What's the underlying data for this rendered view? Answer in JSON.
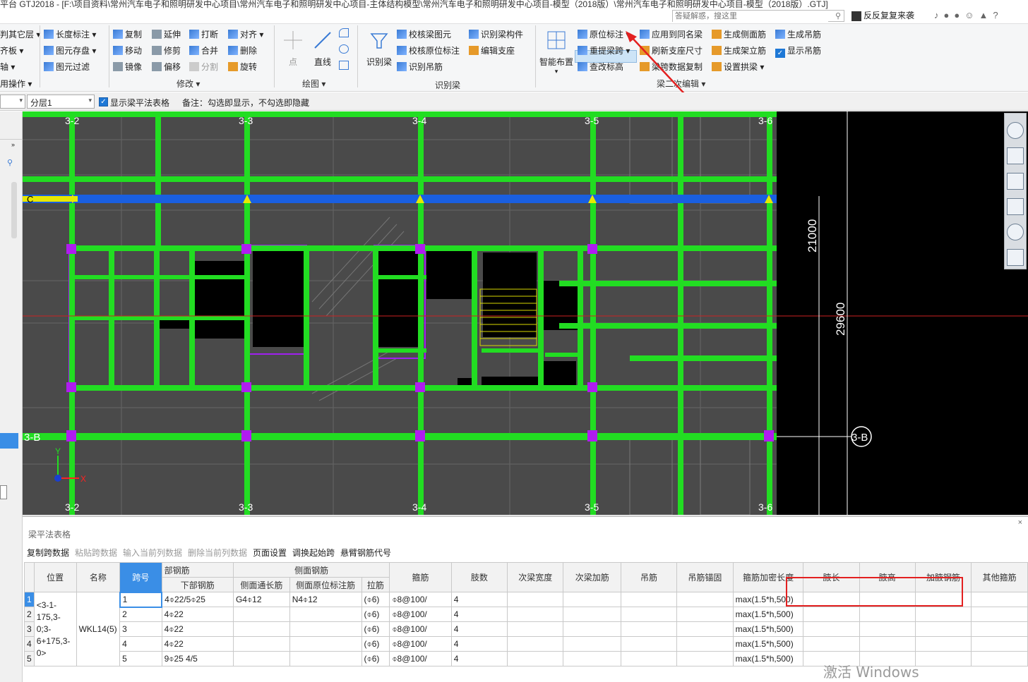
{
  "titlebar": {
    "title": "平台 GTJ2018 - [F:\\项目资料\\常州汽车电子和照明研发中心项目\\常州汽车电子和照明研发中心项目-主体结构模型\\常州汽车电子和照明研发中心项目-模型（2018版）\\常州汽车电子和照明研发中心项目-模型（2018版）.GTJ]",
    "search_placeholder": "答疑解惑，搜这里",
    "user": "反反复复来袭"
  },
  "ribbon": {
    "col1": [
      "判其它层",
      "齐板",
      "轴",
      "用操作"
    ],
    "col2": [
      "长度标注",
      "图元存盘",
      "图元过滤"
    ],
    "modify": {
      "items": [
        "复制",
        "延伸",
        "打断",
        "对齐",
        "移动",
        "修剪",
        "合并",
        "删除",
        "镜像",
        "偏移",
        "分割",
        "旋转"
      ],
      "label": "修改"
    },
    "draw": {
      "point": "点",
      "line": "直线",
      "label": "绘图"
    },
    "identify": {
      "big": "识别梁",
      "items": [
        "校核梁图元",
        "识别梁构件",
        "校核原位标注",
        "编辑支座",
        "识别吊筋"
      ],
      "label": "识别梁"
    },
    "smart": {
      "big": "智能布置"
    },
    "beam_edit": {
      "items": [
        "原位标注",
        "应用到同名梁",
        "生成侧面筋",
        "生成吊筋",
        "重提梁跨",
        "刷新支座尺寸",
        "生成架立筋",
        "显示吊筋",
        "查改标高",
        "梁跨数据复制",
        "设置拱梁"
      ],
      "label": "梁二次编辑"
    }
  },
  "layerbar": {
    "layer_value": "分层1",
    "show_table_label": "显示梁平法表格",
    "note": "备注：勾选即显示，不勾选即隐藏"
  },
  "cad": {
    "axes_top": [
      "3-2",
      "3-3",
      "3-4",
      "3-5",
      "3-6"
    ],
    "axes_bottom": [
      "3-2",
      "3-3",
      "3-4",
      "3-5",
      "3-6"
    ],
    "axis_left_b": "3-B",
    "axis_right_b": "3-B",
    "axis_left_c": "C",
    "dim_1": "21000",
    "dim_2": "29600",
    "ucs_x": "X",
    "ucs_y": "Y"
  },
  "bottom_panel": {
    "title": "梁平法表格",
    "toolbar": [
      "复制跨数据",
      "粘贴跨数据",
      "输入当前列数据",
      "删除当前列数据",
      "页面设置",
      "调换起始跨",
      "悬臂钢筋代号"
    ],
    "headers": {
      "position": "位置",
      "name": "名称",
      "span": "跨号",
      "bottom_rebar_group": "部钢筋",
      "bottom_rebar": "下部钢筋",
      "side_group": "侧面钢筋",
      "side_through": "侧面通长筋",
      "side_local": "侧面原位标注筋",
      "tie": "拉筋",
      "stirrup": "箍筋",
      "legs": "肢数",
      "sec_width": "次梁宽度",
      "sec_add": "次梁加筋",
      "hanger": "吊筋",
      "hanger_anchor": "吊筋锚固",
      "dense_len": "箍筋加密长度",
      "haunch_len": "腋长",
      "haunch_h": "腋高",
      "haunch_rebar": "加腋钢筋",
      "other_stirrup": "其他箍筋"
    },
    "position_value": "<3-1-175,3-0;3-6+175,3-0>",
    "name_value": "WKL14(5)",
    "rows": [
      {
        "idx": "1",
        "span": "1",
        "bottom": "4⌽22/5⌽25",
        "side_through": "G4⌽12",
        "side_local": "N4⌽12",
        "tie": "(⌽6)",
        "stirrup": "⌽8@100/",
        "legs": "4",
        "dense": "max(1.5*h,500)"
      },
      {
        "idx": "2",
        "span": "2",
        "bottom": "4⌽22",
        "side_through": "",
        "side_local": "",
        "tie": "(⌽6)",
        "stirrup": "⌽8@100/",
        "legs": "4",
        "dense": "max(1.5*h,500)"
      },
      {
        "idx": "3",
        "span": "3",
        "bottom": "4⌽22",
        "side_through": "",
        "side_local": "",
        "tie": "(⌽6)",
        "stirrup": "⌽8@100/",
        "legs": "4",
        "dense": "max(1.5*h,500)"
      },
      {
        "idx": "4",
        "span": "4",
        "bottom": "4⌽22",
        "side_through": "",
        "side_local": "",
        "tie": "(⌽6)",
        "stirrup": "⌽8@100/",
        "legs": "4",
        "dense": "max(1.5*h,500)"
      },
      {
        "idx": "5",
        "span": "5",
        "bottom": "9⌽25 4/5",
        "side_through": "",
        "side_local": "",
        "tie": "(⌽6)",
        "stirrup": "⌽8@100/",
        "legs": "4",
        "dense": "max(1.5*h,500)"
      }
    ]
  },
  "watermark": "激活 Windows",
  "colors": {
    "accent": "#1e78d6",
    "beam": "#22dd22",
    "highlight": "#e32020"
  }
}
